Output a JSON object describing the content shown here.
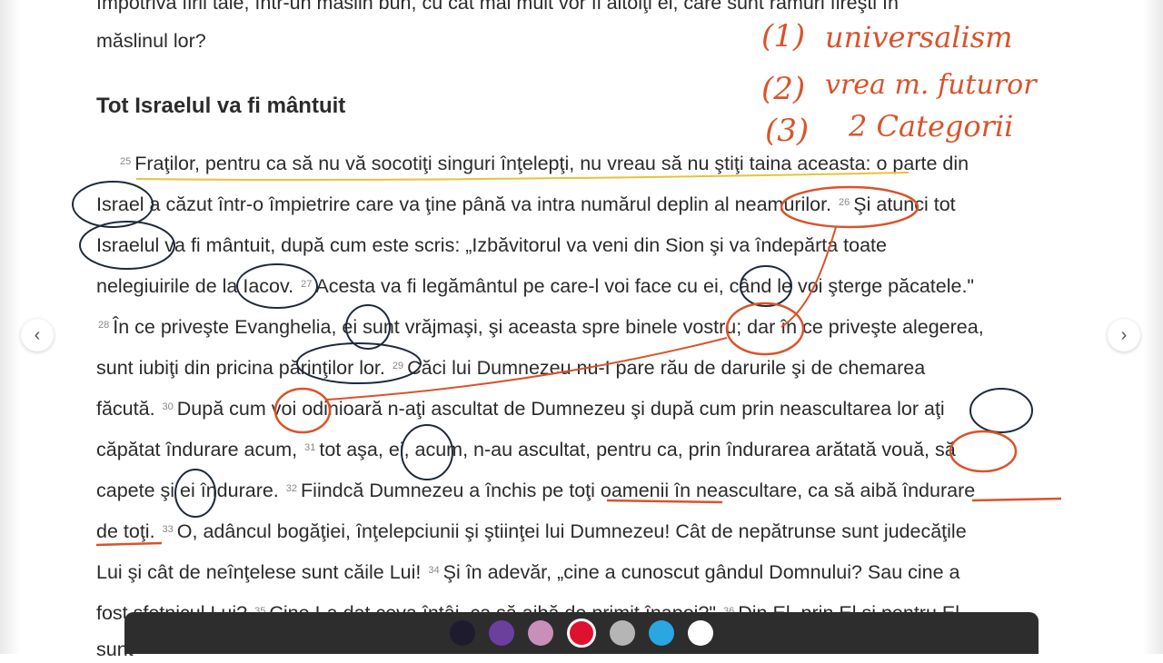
{
  "reader": {
    "lines": [
      "împotriva firii tale, într-un măslin bun, cu cât mai mult vor fi altoiţi ei, care sunt ramuri fireşti în",
      "măslinul lor?"
    ],
    "heading": "Tot Israelul va fi mântuit",
    "body": [
      {
        "v": "25",
        "t": "Fraţilor, pentru ca să nu vă socotiţi singuri înţelepţi, nu vreau să nu ştiţi taina aceasta: o parte din"
      },
      {
        "v": "",
        "t": "Israel a căzut într-o împietrire care va ţine până va intra numărul deplin al neamurilor."
      },
      {
        "v": "26",
        "t": "Şi atunci tot"
      },
      {
        "v": "",
        "t": "Israelul va fi mântuit, după cum este scris: „Izbăvitorul va veni din Sion şi va îndepărta toate"
      },
      {
        "v": "",
        "t": "nelegiuirile de la Iacov."
      },
      {
        "v": "27",
        "t": "Acesta va fi legământul pe care-l voi face cu ei, când le voi şterge păcatele.\""
      },
      {
        "v": "28",
        "t": "În ce priveşte Evanghelia, ei sunt vrăjmaşi, şi aceasta spre binele vostru; dar în ce priveşte alegerea,"
      },
      {
        "v": "",
        "t": "sunt iubiţi din pricina părinţilor lor."
      },
      {
        "v": "29",
        "t": "Căci lui Dumnezeu nu-I pare rău de darurile şi de chemarea"
      },
      {
        "v": "",
        "t": "făcută."
      },
      {
        "v": "30",
        "t": "După cum voi odinioară n-aţi ascultat de Dumnezeu şi după cum prin neascultarea lor aţi"
      },
      {
        "v": "",
        "t": "căpătat îndurare acum,"
      },
      {
        "v": "31",
        "t": "tot aşa, ei, acum, n-au ascultat, pentru ca, prin îndurarea arătată vouă, să"
      },
      {
        "v": "",
        "t": "capete şi ei îndurare."
      },
      {
        "v": "32",
        "t": "Fiindcă Dumnezeu a închis pe toţi oamenii în neascultare, ca să aibă îndurare"
      },
      {
        "v": "",
        "t": "de toţi."
      },
      {
        "v": "33",
        "t": "O, adâncul bogăţiei, înţelepciunii şi ştiinţei lui Dumnezeu! Cât de nepătrunse sunt judecăţile"
      },
      {
        "v": "",
        "t": "Lui şi cât de neînţelese sunt căile Lui!"
      },
      {
        "v": "34",
        "t": "Şi în adevăr, „cine a cunoscut gândul Domnului? Sau cine a"
      },
      {
        "v": "",
        "t": "fost sfetnicul Lui?"
      },
      {
        "v": "35",
        "t": "Cine I-a dat ceva întâi, ca să aibă de primit înapoi?\""
      },
      {
        "v": "36",
        "t": "Din El, prin El şi pentru El"
      },
      {
        "v": "",
        "t": "sunt"
      }
    ]
  },
  "handwriting": {
    "n1": "(1)",
    "w1": "universalism",
    "n2": "(2)",
    "w2": "vrea m. futuror",
    "n3": "(3)",
    "w3": "2 Categorii"
  },
  "navigation": {
    "prev_glyph": "‹",
    "next_glyph": "›"
  },
  "toolbar": {
    "colors": [
      "#1f1b2e",
      "#6b3fa0",
      "#c88fb8",
      "#e0102f",
      "#b5b5b5",
      "#2aa6e0",
      "#ffffff"
    ],
    "selected_index": 3
  },
  "ink_colors": {
    "orange": "#d9532b",
    "navy": "#1e2a3a",
    "yellow": "#e8c23a"
  }
}
